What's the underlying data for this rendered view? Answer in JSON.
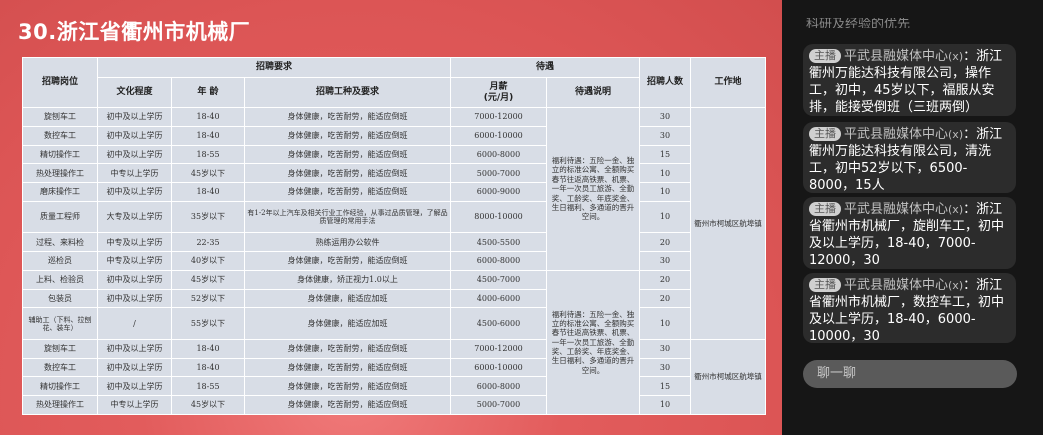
{
  "slide": {
    "title": "30.浙江省衢州市机械厂",
    "headers": {
      "post": "招聘岗位",
      "requirements": "招聘要求",
      "benefits": "待遇",
      "count": "招聘人数",
      "location": "工作地",
      "education": "文化程度",
      "age": "年 龄",
      "type_req": "招聘工种及要求",
      "salary": "月薪\n(元/月)",
      "benefit_desc": "待遇说明"
    },
    "rows": [
      {
        "post": "旋刨车工",
        "edu": "初中及以上学历",
        "age": "18-40",
        "req": "身体健康，吃苦耐劳，能适应倒班",
        "salary": "7000-12000",
        "count": "30"
      },
      {
        "post": "数控车工",
        "edu": "初中及以上学历",
        "age": "18-40",
        "req": "身体健康，吃苦耐劳，能适应倒班",
        "salary": "6000-10000",
        "count": "30"
      },
      {
        "post": "精切操作工",
        "edu": "初中及以上学历",
        "age": "18-55",
        "req": "身体健康，吃苦耐劳，能适应倒班",
        "salary": "6000-8000",
        "count": "15"
      },
      {
        "post": "热处理操作工",
        "edu": "中专以上学历",
        "age": "45岁以下",
        "req": "身体健康，吃苦耐劳，能适应倒班",
        "salary": "5000-7000",
        "count": "10"
      },
      {
        "post": "磨床操作工",
        "edu": "初中及以上学历",
        "age": "18-40",
        "req": "身体健康，吃苦耐劳，能适应倒班",
        "salary": "6000-9000",
        "count": "10"
      },
      {
        "post": "质量工程师",
        "edu": "大专及以上学历",
        "age": "35岁以下",
        "req": "有1-2年以上汽车及相关行业工作经验，从事过品质管理，了解品质管理的常用手法",
        "salary": "8000-10000",
        "count": "10"
      },
      {
        "post": "过程、来料检",
        "edu": "中专及以上学历",
        "age": "22-35",
        "req": "熟练运用办公软件",
        "salary": "4500-5500",
        "count": "20"
      },
      {
        "post": "巡检员",
        "edu": "中专及以上学历",
        "age": "40岁以下",
        "req": "身体健康，吃苦耐劳，能适应倒班",
        "salary": "6000-8000",
        "count": "30"
      },
      {
        "post": "上料、检验员",
        "edu": "初中及以上学历",
        "age": "45岁以下",
        "req": "身体健康，矫正视力1.0以上",
        "salary": "4500-7000",
        "count": "20"
      },
      {
        "post": "包装员",
        "edu": "初中及以上学历",
        "age": "52岁以下",
        "req": "身体健康，能适应加班",
        "salary": "4000-6000",
        "count": "20"
      },
      {
        "post": "辅助工（下料、拉刨花、装车）",
        "edu": "/",
        "age": "55岁以下",
        "req": "身体健康，能适应加班",
        "salary": "4500-6000",
        "count": "10"
      },
      {
        "post": "旋刨车工",
        "edu": "初中及以上学历",
        "age": "18-40",
        "req": "身体健康，吃苦耐劳，能适应倒班",
        "salary": "7000-12000",
        "count": "30"
      },
      {
        "post": "数控车工",
        "edu": "初中及以上学历",
        "age": "18-40",
        "req": "身体健康，吃苦耐劳，能适应倒班",
        "salary": "6000-10000",
        "count": "30"
      },
      {
        "post": "精切操作工",
        "edu": "初中及以上学历",
        "age": "18-55",
        "req": "身体健康，吃苦耐劳，能适应倒班",
        "salary": "6000-8000",
        "count": "15"
      },
      {
        "post": "热处理操作工",
        "edu": "中专以上学历",
        "age": "45岁以下",
        "req": "身体健康，吃苦耐劳，能适应倒班",
        "salary": "5000-7000",
        "count": "10"
      }
    ],
    "benefit_note_1": "福利待遇：五险一金、独立的标准公寓、全额购买春节往返高铁票、机票、一年一次员工旅游、全勤奖、工龄奖、年底奖金、生日福利、多通道的晋升空间。",
    "benefit_note_2": "福利待遇：五险一金、独立的标准公寓、全额购买春节往返高铁票、机票、一年一次员工旅游、全勤奖、工龄奖、年底奖金、生日福利、多通道的晋升空间。",
    "location_1": "衢州市柯城区航埠镇",
    "location_2": "衢州市柯城区航埠镇"
  },
  "panel": {
    "clipped_text": "科研及经验的优先",
    "comments": [
      {
        "badge": "主播",
        "author": "平武县融媒体中心",
        "emoji": "(x)",
        "text": "：浙江衢州万能达科技有限公司，操作工，初中，45岁以下，福服从安排，能接受倒班（三班两倒）"
      },
      {
        "badge": "主播",
        "author": "平武县融媒体中心",
        "emoji": "(x)",
        "text": "：浙江衢州万能达科技有限公司，清洗工，初中52岁以下，6500-8000，15人"
      },
      {
        "badge": "主播",
        "author": "平武县融媒体中心",
        "emoji": "(x)",
        "text": "：浙江省衢州市机械厂，旋削车工，初中及以上学历，18-40，7000-12000，30"
      },
      {
        "badge": "主播",
        "author": "平武县融媒体中心",
        "emoji": "(x)",
        "text": "：浙江省衢州市机械厂，数控车工，初中及以上学历，18-40，6000-10000，30"
      }
    ],
    "chat_placeholder": "聊一聊"
  }
}
